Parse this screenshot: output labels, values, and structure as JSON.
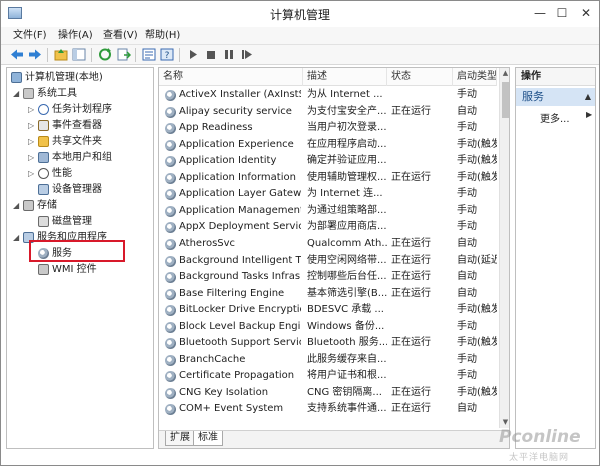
{
  "window": {
    "title": "计算机管理",
    "controls": {
      "minimize": "—",
      "maximize": "☐",
      "close": "✕"
    }
  },
  "menu": [
    "文件(F)",
    "操作(A)",
    "查看(V)",
    "帮助(H)"
  ],
  "toolbar": {
    "icons": [
      "back-icon",
      "forward-icon",
      "up-folder-icon",
      "console-tree-icon",
      "refresh-icon",
      "export-list-icon",
      "properties-icon",
      "help-icon",
      "start-service-icon",
      "stop-service-icon",
      "pause-service-icon",
      "restart-service-icon"
    ]
  },
  "tree": {
    "root": "计算机管理(本地)",
    "system_tools": "系统工具",
    "task_scheduler": "任务计划程序",
    "event_viewer": "事件查看器",
    "shared_folders": "共享文件夹",
    "local_users": "本地用户和组",
    "performance": "性能",
    "device_manager": "设备管理器",
    "storage": "存储",
    "disk_management": "磁盘管理",
    "services_apps": "服务和应用程序",
    "services": "服务",
    "wmi": "WMI 控件"
  },
  "columns": {
    "name": "名称",
    "description": "描述",
    "status": "状态",
    "startup": "启动类型"
  },
  "services": [
    {
      "name": "ActiveX Installer (AxInstSV)",
      "description": "为从 Internet ...",
      "status": "",
      "startup": "手动"
    },
    {
      "name": "Alipay security service",
      "description": "为支付宝安全产...",
      "status": "正在运行",
      "startup": "自动"
    },
    {
      "name": "App Readiness",
      "description": "当用户初次登录...",
      "status": "",
      "startup": "手动"
    },
    {
      "name": "Application Experience",
      "description": "在应用程序启动...",
      "status": "",
      "startup": "手动(触发"
    },
    {
      "name": "Application Identity",
      "description": "确定并验证应用...",
      "status": "",
      "startup": "手动(触发"
    },
    {
      "name": "Application Information",
      "description": "使用辅助管理权...",
      "status": "正在运行",
      "startup": "手动(触发"
    },
    {
      "name": "Application Layer Gatewa...",
      "description": "为 Internet 连...",
      "status": "",
      "startup": "手动"
    },
    {
      "name": "Application Management",
      "description": "为通过组策略部...",
      "status": "",
      "startup": "手动"
    },
    {
      "name": "AppX Deployment Servic...",
      "description": "为部署应用商店...",
      "status": "",
      "startup": "手动"
    },
    {
      "name": "AtherosSvc",
      "description": "Qualcomm Ath...",
      "status": "正在运行",
      "startup": "自动"
    },
    {
      "name": "Background Intelligent T...",
      "description": "使用空闲网络带...",
      "status": "正在运行",
      "startup": "自动(延迟"
    },
    {
      "name": "Background Tasks Infras...",
      "description": "控制哪些后台任...",
      "status": "正在运行",
      "startup": "自动"
    },
    {
      "name": "Base Filtering Engine",
      "description": "基本筛选引擎(B...",
      "status": "正在运行",
      "startup": "自动"
    },
    {
      "name": "BitLocker Drive Encryptio...",
      "description": "BDESVC 承载 ...",
      "status": "",
      "startup": "手动(触发"
    },
    {
      "name": "Block Level Backup Engi...",
      "description": "Windows 备份...",
      "status": "",
      "startup": "手动"
    },
    {
      "name": "Bluetooth Support Service",
      "description": "Bluetooth 服务...",
      "status": "正在运行",
      "startup": "手动(触发"
    },
    {
      "name": "BranchCache",
      "description": "此服务缓存来自...",
      "status": "",
      "startup": "手动"
    },
    {
      "name": "Certificate Propagation",
      "description": "将用户证书和根...",
      "status": "",
      "startup": "手动"
    },
    {
      "name": "CNG Key Isolation",
      "description": "CNG 密钥隔离...",
      "status": "正在运行",
      "startup": "手动(触发"
    },
    {
      "name": "COM+ Event System",
      "description": "支持系统事件通...",
      "status": "正在运行",
      "startup": "自动"
    }
  ],
  "tabs": [
    "扩展",
    "标准"
  ],
  "actions": {
    "header": "操作",
    "section": "服务",
    "more": "更多..."
  },
  "watermark": {
    "brand": "Pconline",
    "sub": "太平洋电脑网"
  },
  "colors": {
    "selection_box": "#d8192a",
    "action_section_bg": "#d5e4f5",
    "action_section_text": "#1d4f88"
  }
}
